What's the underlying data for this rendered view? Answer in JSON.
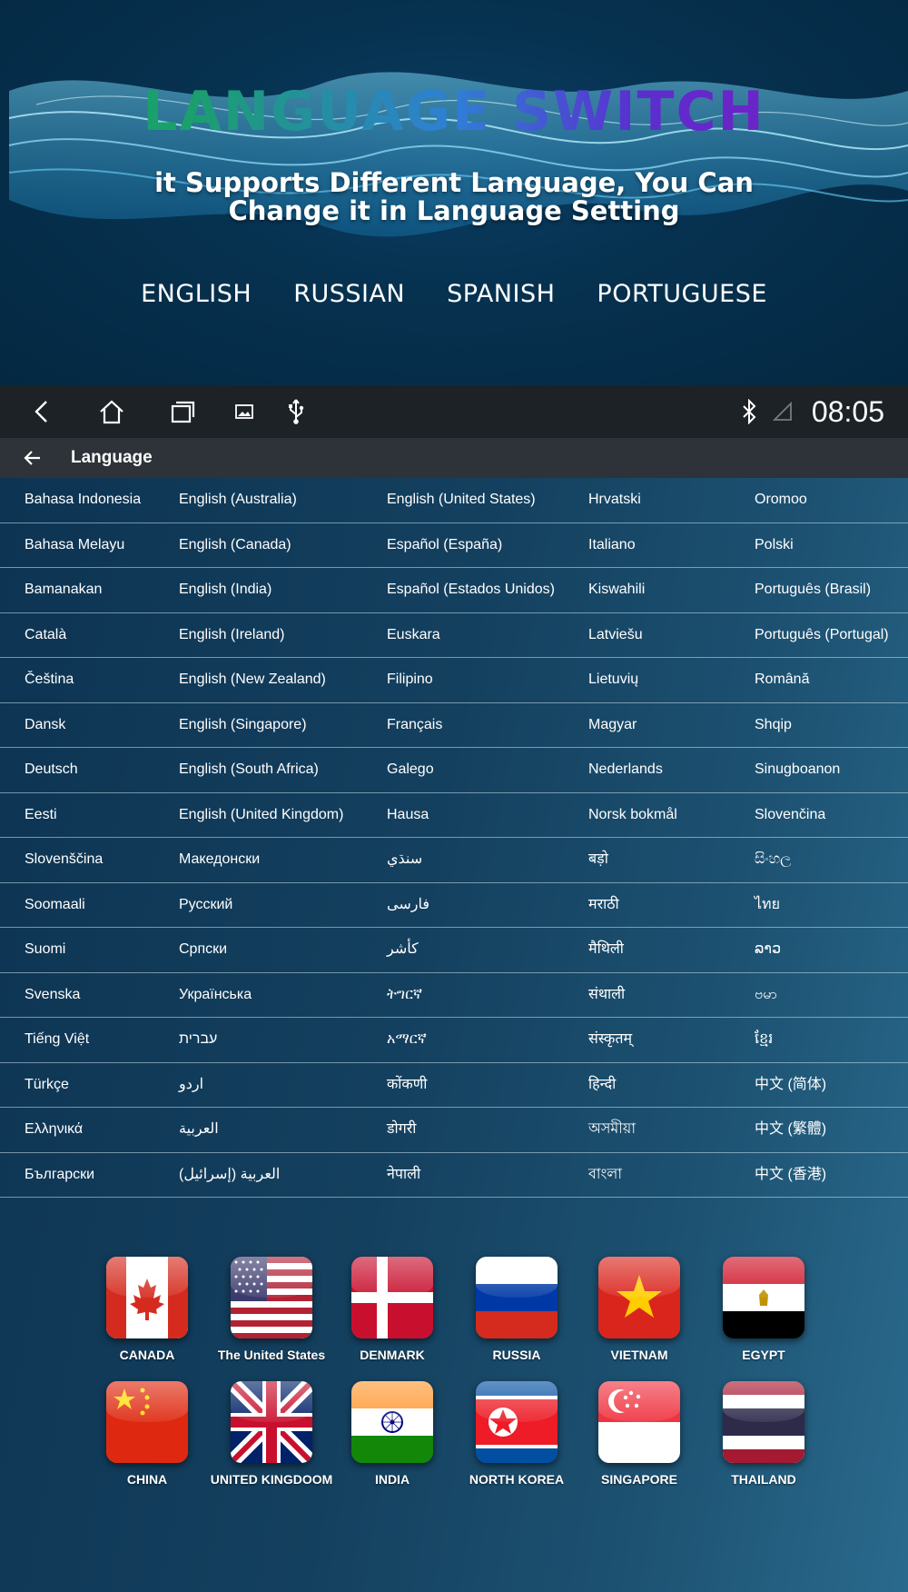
{
  "hero": {
    "title": "LANGUAGE SWITCH",
    "subtitle": "it Supports Different Language, You Can Change it in Language Setting",
    "languages": [
      "ENGLISH",
      "RUSSIAN",
      "SPANISH",
      "PORTUGUESE"
    ]
  },
  "statusbar": {
    "nav_icons": [
      "back-icon",
      "home-icon",
      "recent-apps-icon",
      "gallery-icon",
      "usb-icon"
    ],
    "status_icons": [
      "bluetooth-icon",
      "signal-icon"
    ],
    "time": "08:05"
  },
  "actionbar": {
    "back_icon": "arrow-left-icon",
    "title": "Language"
  },
  "languages": {
    "rows": [
      [
        "Bahasa Indonesia",
        "English (Australia)",
        "English (United States)",
        "Hrvatski",
        "Oromoo"
      ],
      [
        "Bahasa Melayu",
        "English (Canada)",
        "Español (España)",
        "Italiano",
        "Polski"
      ],
      [
        "Bamanakan",
        "English (India)",
        "Español (Estados Unidos)",
        "Kiswahili",
        "Português (Brasil)"
      ],
      [
        "Català",
        "English (Ireland)",
        "Euskara",
        "Latviešu",
        "Português (Portugal)"
      ],
      [
        "Čeština",
        "English (New Zealand)",
        "Filipino",
        "Lietuvių",
        "Română"
      ],
      [
        "Dansk",
        "English (Singapore)",
        "Français",
        "Magyar",
        "Shqip"
      ],
      [
        "Deutsch",
        "English (South Africa)",
        "Galego",
        "Nederlands",
        "Sinugboanon"
      ],
      [
        "Eesti",
        "English (United Kingdom)",
        "Hausa",
        "Norsk bokmål",
        "Slovenčina"
      ],
      [
        "Slovenščina",
        "Македонски",
        "سنڌي",
        "बड़ो",
        "සිංහල"
      ],
      [
        "Soomaali",
        "Русский",
        "فارسی",
        "मराठी",
        "ไทย"
      ],
      [
        "Suomi",
        "Српски",
        "كأشر",
        "मैथिली",
        "ລາວ"
      ],
      [
        "Svenska",
        "Українська",
        "ትግርኛ",
        "संथाली",
        "ဗမာ"
      ],
      [
        "Tiếng Việt",
        "עברית",
        "አማርኛ",
        "संस्कृतम्",
        "ខ្មែរ"
      ],
      [
        "Türkçe",
        "اردو",
        "कोंकणी",
        "हिन्दी",
        "中文 (简体)"
      ],
      [
        "Ελληνικά",
        "العربية",
        "डोगरी",
        "অসমীয়া",
        "中文 (繁體)"
      ],
      [
        "Български",
        "العربية (إسرائيل)",
        "नेपाली",
        "বাংলা",
        "中文 (香港)"
      ]
    ]
  },
  "flags": {
    "row1": [
      "CANADA",
      "The United States",
      "DENMARK",
      "RUSSIA",
      "VIETNAM",
      "EGYPT"
    ],
    "row2": [
      "CHINA",
      "UNITED KINGDOOM",
      "INDIA",
      "NORTH KOREA",
      "SINGAPORE",
      "THAILAND"
    ]
  },
  "colors": {
    "hero_bg": "#042841",
    "statusbar_bg": "#1d2226",
    "actionbar_bg": "#2d3338",
    "title_gradient_start": "#1aa06a",
    "title_gradient_end": "#6a25c8"
  }
}
